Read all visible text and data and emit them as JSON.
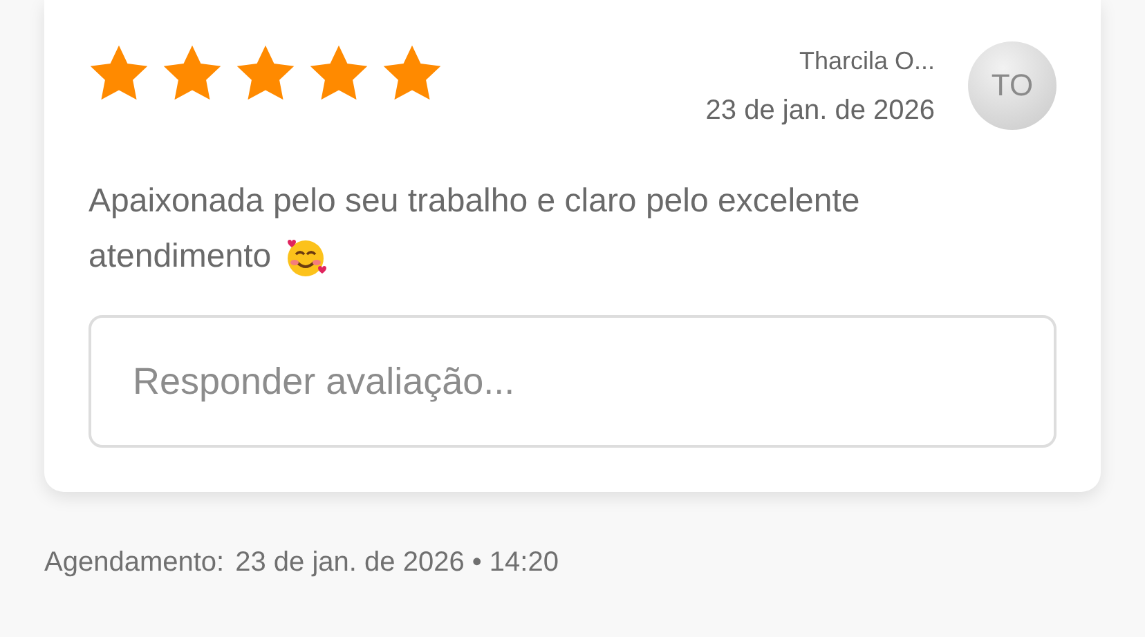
{
  "review": {
    "stars": 5,
    "author": "Tharcila O...",
    "date": "23 de jan. de 2026",
    "avatar_initials": "TO",
    "text_lines": [
      "Apaixonada pelo seu trabalho e claro pelo excelente",
      "atendimento"
    ],
    "reply": {
      "placeholder": "Responder avaliação..."
    }
  },
  "appointment": {
    "label": "Agendamento:",
    "value": "23 de jan. de 2026 • 14:20"
  }
}
